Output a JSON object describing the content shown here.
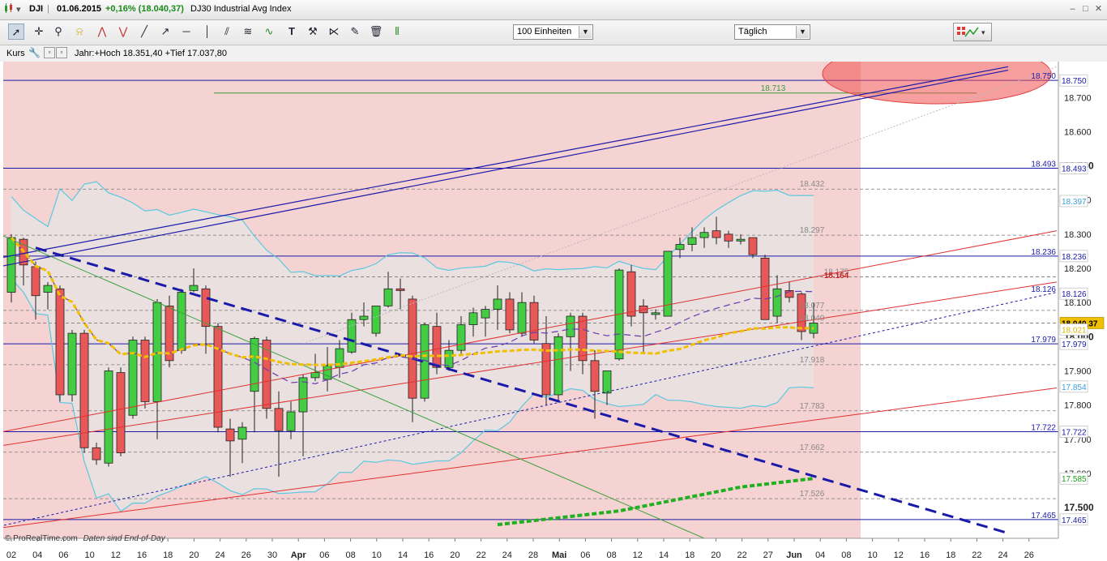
{
  "window": {
    "symbol": "DJI",
    "date": "01.06.2015",
    "change": "+0,16% (18.040,37)",
    "name": "DJ30 Industrial Avg Index"
  },
  "toolbar": {
    "tools": [
      "cursor-arrow",
      "cross-cursor",
      "zoom-magnifier",
      "alarm-bell",
      "trend-up-tool",
      "trend-down-tool",
      "line-tool",
      "ray-tool",
      "horizontal-line-tool",
      "vertical-line-tool",
      "parallel-lines-tool",
      "fibonacci-tool",
      "wave-tool",
      "text-tool",
      "hammer-tool",
      "magnet-tool",
      "pen-tool",
      "trash-icon",
      "bars-tool"
    ],
    "units_select": "100 Einheiten",
    "period_select": "Täglich"
  },
  "panel": {
    "label": "Kurs",
    "info": "Jahr:+Hoch 18.351,40 +Tief 17.037,80"
  },
  "footer": {
    "source": "© ProRealTime.com",
    "note": "Daten sind End-of-Day"
  },
  "colors": {
    "up": "#44cc44",
    "down": "#e85858",
    "zone": "#f6d3d3",
    "band": "#5bc8e0",
    "blue_line": "#1a1aa8",
    "current_price": "#f0c000"
  },
  "chart_data": {
    "type": "candlestick",
    "ylim": [
      17410,
      18805
    ],
    "y_ticks": [
      "17.500",
      "17.600",
      "17.700",
      "17.800",
      "17.900",
      "18.000",
      "18.100",
      "18.200",
      "18.300",
      "18.400",
      "18.500",
      "18.600",
      "18.700"
    ],
    "x_ticks": [
      "02",
      "04",
      "06",
      "10",
      "12",
      "16",
      "18",
      "20",
      "24",
      "26",
      "30",
      "Apr",
      "06",
      "08",
      "10",
      "14",
      "16",
      "20",
      "22",
      "24",
      "28",
      "Mai",
      "06",
      "08",
      "12",
      "14",
      "18",
      "20",
      "22",
      "27",
      "Jun",
      "04",
      "08",
      "10",
      "12",
      "16",
      "18",
      "22",
      "24",
      "26"
    ],
    "axis_labels_right": [
      {
        "value": 18750,
        "text": "18.750",
        "color": "#1a1aa8"
      },
      {
        "value": 18493,
        "text": "18.493",
        "color": "#1a1aa8"
      },
      {
        "value": 18397,
        "text": "18.397",
        "color": "#3aa0d8"
      },
      {
        "value": 18236,
        "text": "18.236",
        "color": "#1a1aa8"
      },
      {
        "value": 18126,
        "text": "18.126",
        "color": "#1a1aa8"
      },
      {
        "value": 18040,
        "text": "18.040,37",
        "color": "#000000"
      },
      {
        "value": 18021,
        "text": "18.021",
        "color": "#d8b800"
      },
      {
        "value": 17979,
        "text": "17.979",
        "color": "#1a1aa8"
      },
      {
        "value": 17854,
        "text": "17.854",
        "color": "#3aa0d8"
      },
      {
        "value": 17722,
        "text": "17.722",
        "color": "#1a1aa8"
      },
      {
        "value": 17585,
        "text": "17.585",
        "color": "#20a020"
      },
      {
        "value": 17465,
        "text": "17.465",
        "color": "#1a1aa8"
      }
    ],
    "level_labels": [
      {
        "value": 18713,
        "text": "18.713",
        "color": "#3a9a3a"
      },
      {
        "value": 18432,
        "text": "18.432",
        "color": "#888888"
      },
      {
        "value": 18297,
        "text": "18.297",
        "color": "#888888"
      },
      {
        "value": 18175,
        "text": "18.175",
        "color": "#888888"
      },
      {
        "value": 18164,
        "text": "18.164",
        "color": "#cc2222"
      },
      {
        "value": 18077,
        "text": "18.077",
        "color": "#888888"
      },
      {
        "value": 18040,
        "text": "18.040",
        "color": "#888888"
      },
      {
        "value": 17918,
        "text": "17.918",
        "color": "#888888"
      },
      {
        "value": 17783,
        "text": "17.783",
        "color": "#888888"
      },
      {
        "value": 17662,
        "text": "17.662",
        "color": "#888888"
      },
      {
        "value": 17526,
        "text": "17.526",
        "color": "#888888"
      }
    ],
    "candles": [
      {
        "o": 18130,
        "h": 18300,
        "l": 18100,
        "c": 18290
      },
      {
        "o": 18285,
        "h": 18290,
        "l": 18150,
        "c": 18210
      },
      {
        "o": 18205,
        "h": 18220,
        "l": 18050,
        "c": 18120
      },
      {
        "o": 18130,
        "h": 18160,
        "l": 18080,
        "c": 18150
      },
      {
        "o": 18140,
        "h": 18150,
        "l": 17810,
        "c": 17830
      },
      {
        "o": 17830,
        "h": 18020,
        "l": 17810,
        "c": 18010
      },
      {
        "o": 18010,
        "h": 18020,
        "l": 17660,
        "c": 17675
      },
      {
        "o": 17675,
        "h": 17690,
        "l": 17625,
        "c": 17640
      },
      {
        "o": 17630,
        "h": 17910,
        "l": 17620,
        "c": 17900
      },
      {
        "o": 17895,
        "h": 17910,
        "l": 17650,
        "c": 17660
      },
      {
        "o": 17770,
        "h": 18000,
        "l": 17760,
        "c": 17990
      },
      {
        "o": 17990,
        "h": 18000,
        "l": 17790,
        "c": 17810
      },
      {
        "o": 17810,
        "h": 18110,
        "l": 17700,
        "c": 18100
      },
      {
        "o": 18090,
        "h": 18120,
        "l": 17910,
        "c": 17930
      },
      {
        "o": 17960,
        "h": 18140,
        "l": 17950,
        "c": 18130
      },
      {
        "o": 18135,
        "h": 18200,
        "l": 18130,
        "c": 18150
      },
      {
        "o": 18140,
        "h": 18150,
        "l": 17950,
        "c": 18030
      },
      {
        "o": 18030,
        "h": 18040,
        "l": 17720,
        "c": 17735
      },
      {
        "o": 17730,
        "h": 17760,
        "l": 17590,
        "c": 17695
      },
      {
        "o": 17700,
        "h": 17750,
        "l": 17630,
        "c": 17735
      },
      {
        "o": 17840,
        "h": 18000,
        "l": 17720,
        "c": 17995
      },
      {
        "o": 17990,
        "h": 18000,
        "l": 17760,
        "c": 17790
      },
      {
        "o": 17790,
        "h": 17840,
        "l": 17590,
        "c": 17725
      },
      {
        "o": 17725,
        "h": 17810,
        "l": 17700,
        "c": 17780
      },
      {
        "o": 17780,
        "h": 17890,
        "l": 17650,
        "c": 17880
      },
      {
        "o": 17880,
        "h": 17950,
        "l": 17870,
        "c": 17895
      },
      {
        "o": 17875,
        "h": 17970,
        "l": 17840,
        "c": 17915
      },
      {
        "o": 17910,
        "h": 17990,
        "l": 17880,
        "c": 17965
      },
      {
        "o": 17955,
        "h": 18070,
        "l": 17950,
        "c": 18050
      },
      {
        "o": 18050,
        "h": 18100,
        "l": 18030,
        "c": 18060
      },
      {
        "o": 18010,
        "h": 18080,
        "l": 18000,
        "c": 18090
      },
      {
        "o": 18090,
        "h": 18190,
        "l": 18085,
        "c": 18140
      },
      {
        "o": 18140,
        "h": 18170,
        "l": 18080,
        "c": 18135
      },
      {
        "o": 18110,
        "h": 18120,
        "l": 17750,
        "c": 17820
      },
      {
        "o": 17820,
        "h": 18040,
        "l": 17810,
        "c": 18035
      },
      {
        "o": 18030,
        "h": 18070,
        "l": 17890,
        "c": 17910
      },
      {
        "o": 17910,
        "h": 17990,
        "l": 17900,
        "c": 17960
      },
      {
        "o": 17960,
        "h": 18060,
        "l": 17950,
        "c": 18035
      },
      {
        "o": 18035,
        "h": 18085,
        "l": 18000,
        "c": 18070
      },
      {
        "o": 18055,
        "h": 18090,
        "l": 18000,
        "c": 18080
      },
      {
        "o": 18080,
        "h": 18150,
        "l": 18020,
        "c": 18110
      },
      {
        "o": 18110,
        "h": 18130,
        "l": 18010,
        "c": 18020
      },
      {
        "o": 18010,
        "h": 18130,
        "l": 18000,
        "c": 18100
      },
      {
        "o": 18100,
        "h": 18120,
        "l": 17980,
        "c": 17990
      },
      {
        "o": 17980,
        "h": 18060,
        "l": 17800,
        "c": 17830
      },
      {
        "o": 17830,
        "h": 18010,
        "l": 17810,
        "c": 18000
      },
      {
        "o": 18000,
        "h": 18070,
        "l": 17900,
        "c": 18060
      },
      {
        "o": 18060,
        "h": 18070,
        "l": 17890,
        "c": 17930
      },
      {
        "o": 17930,
        "h": 17960,
        "l": 17760,
        "c": 17840
      },
      {
        "o": 17835,
        "h": 17900,
        "l": 17800,
        "c": 17900
      },
      {
        "o": 17935,
        "h": 18200,
        "l": 17930,
        "c": 18195
      },
      {
        "o": 18190,
        "h": 18210,
        "l": 18030,
        "c": 18060
      },
      {
        "o": 18090,
        "h": 18110,
        "l": 17950,
        "c": 18070
      },
      {
        "o": 18065,
        "h": 18080,
        "l": 18050,
        "c": 18070
      },
      {
        "o": 18060,
        "h": 18250,
        "l": 18060,
        "c": 18250
      },
      {
        "o": 18255,
        "h": 18290,
        "l": 18230,
        "c": 18270
      },
      {
        "o": 18270,
        "h": 18320,
        "l": 18250,
        "c": 18290
      },
      {
        "o": 18290,
        "h": 18320,
        "l": 18260,
        "c": 18305
      },
      {
        "o": 18310,
        "h": 18351,
        "l": 18270,
        "c": 18290
      },
      {
        "o": 18300,
        "h": 18310,
        "l": 18260,
        "c": 18280
      },
      {
        "o": 18280,
        "h": 18300,
        "l": 18270,
        "c": 18285
      },
      {
        "o": 18290,
        "h": 18290,
        "l": 18230,
        "c": 18240
      },
      {
        "o": 18230,
        "h": 18240,
        "l": 18050,
        "c": 18050
      },
      {
        "o": 18060,
        "h": 18180,
        "l": 18040,
        "c": 18140
      },
      {
        "o": 18135,
        "h": 18160,
        "l": 18100,
        "c": 18115
      },
      {
        "o": 18125,
        "h": 18130,
        "l": 17990,
        "c": 18015
      },
      {
        "o": 18010,
        "h": 18100,
        "l": 17995,
        "c": 18040
      }
    ]
  }
}
